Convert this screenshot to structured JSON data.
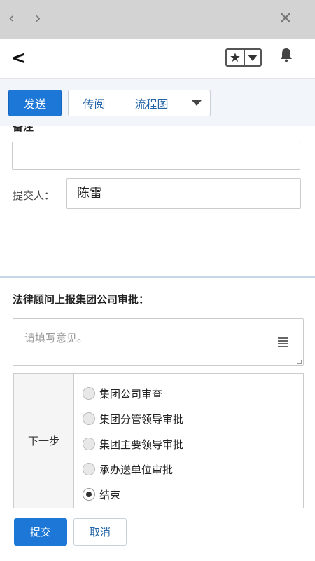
{
  "browser": {
    "back": "‹",
    "forward": "›",
    "close": "✕"
  },
  "header": {
    "back": "‹",
    "star": "★",
    "bell": "🔔"
  },
  "toolbar": {
    "send_label": "发送",
    "circulate_label": "传阅",
    "flowchart_label": "流程图"
  },
  "form": {
    "remark_label": "备注",
    "remark_value": "",
    "submitter_label": "提交人：",
    "submitter_value": "陈雷"
  },
  "approval": {
    "section_title": "法律顾问上报集团公司审批：",
    "opinion_placeholder": "请填写意见。",
    "next_step_label": "下一步",
    "options": [
      {
        "label": "集团公司审查",
        "selected": false
      },
      {
        "label": "集团分管领导审批",
        "selected": false
      },
      {
        "label": "集团主要领导审批",
        "selected": false
      },
      {
        "label": "承办送单位审批",
        "selected": false
      },
      {
        "label": "结束",
        "selected": true
      }
    ]
  },
  "actions": {
    "submit_label": "提交",
    "cancel_label": "取消"
  },
  "colors": {
    "primary": "#1d77d6",
    "link": "#2466a8",
    "divider": "#c6d6e8"
  }
}
